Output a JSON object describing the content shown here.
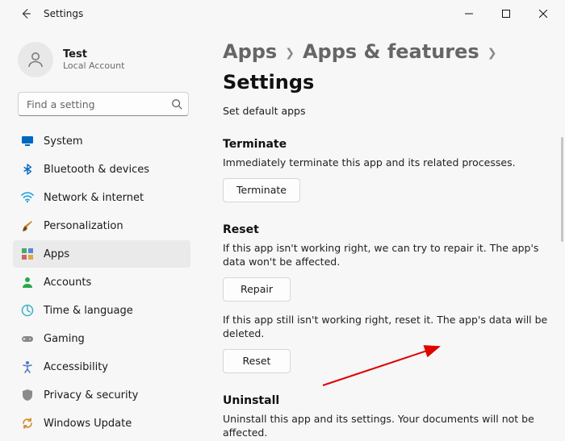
{
  "titlebar": {
    "app_title": "Settings"
  },
  "user": {
    "name": "Test",
    "subtitle": "Local Account"
  },
  "search": {
    "placeholder": "Find a setting"
  },
  "nav": {
    "items": [
      {
        "label": "System"
      },
      {
        "label": "Bluetooth & devices"
      },
      {
        "label": "Network & internet"
      },
      {
        "label": "Personalization"
      },
      {
        "label": "Apps"
      },
      {
        "label": "Accounts"
      },
      {
        "label": "Time & language"
      },
      {
        "label": "Gaming"
      },
      {
        "label": "Accessibility"
      },
      {
        "label": "Privacy & security"
      },
      {
        "label": "Windows Update"
      }
    ]
  },
  "breadcrumb": {
    "a": "Apps",
    "b": "Apps & features",
    "c": "Settings"
  },
  "links": {
    "set_default": "Set default apps"
  },
  "terminate": {
    "title": "Terminate",
    "desc": "Immediately terminate this app and its related processes.",
    "btn": "Terminate"
  },
  "reset": {
    "title": "Reset",
    "desc1": "If this app isn't working right, we can try to repair it. The app's data won't be affected.",
    "repair_btn": "Repair",
    "desc2": "If this app still isn't working right, reset it. The app's data will be deleted.",
    "reset_btn": "Reset"
  },
  "uninstall": {
    "title": "Uninstall",
    "desc": "Uninstall this app and its settings. Your documents will not be affected."
  }
}
